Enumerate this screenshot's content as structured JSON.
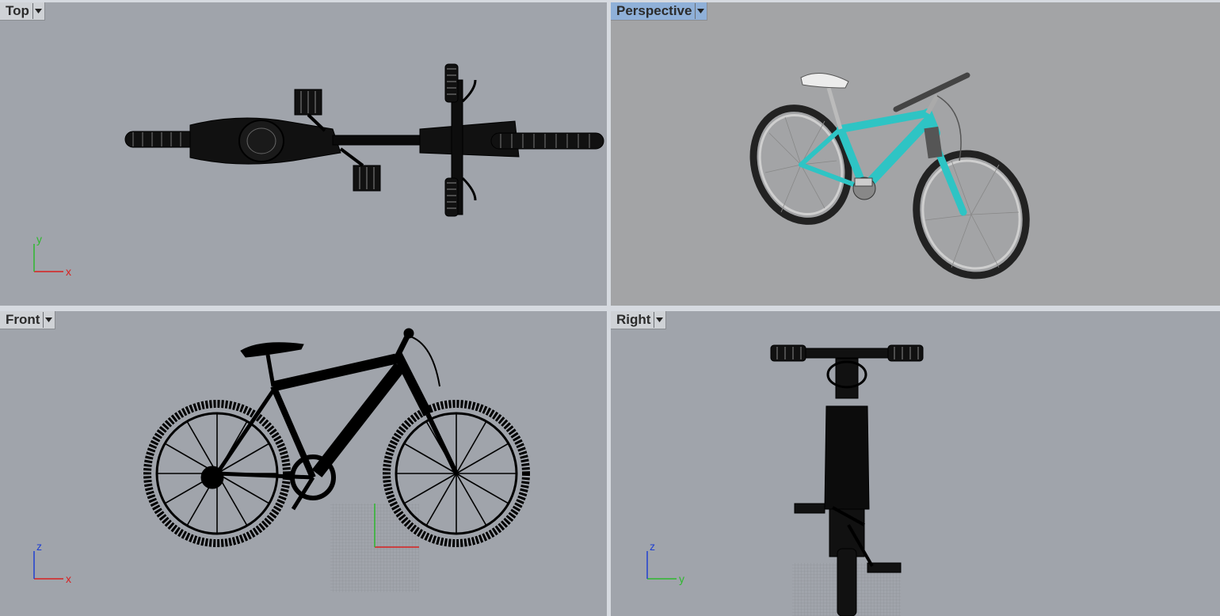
{
  "viewports": {
    "top": {
      "title": "Top",
      "axes": {
        "h": "x",
        "v": "y"
      }
    },
    "perspective": {
      "title": "Perspective"
    },
    "front": {
      "title": "Front",
      "axes": {
        "h": "x",
        "v": "z"
      }
    },
    "right": {
      "title": "Right",
      "axes": {
        "h": "y",
        "v": "z"
      }
    }
  },
  "colors": {
    "viewport_bg": "#a0a4ab",
    "perspective_bg": "#a3a4a6",
    "active_tab": "#8fb0d8",
    "frame_cyan": "#2ec4c4",
    "wireframe": "#000000",
    "axis_x": "#d82020",
    "axis_y": "#2eb82e",
    "axis_z": "#2040d0"
  },
  "icons": [
    "chevron-down-icon",
    "bicycle-model",
    "axis-gizmo",
    "construction-grid"
  ]
}
